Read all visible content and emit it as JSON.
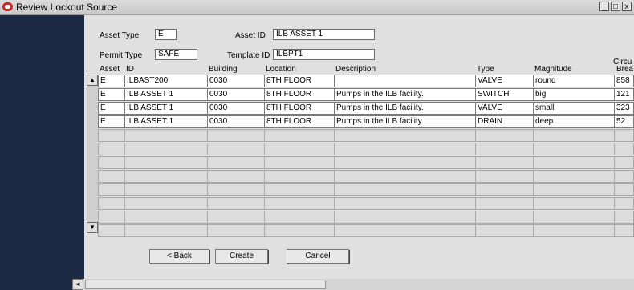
{
  "window": {
    "title": "Review Lockout Source",
    "buttons": [
      "_",
      "□",
      "x"
    ]
  },
  "form": {
    "asset_type_label": "Asset Type",
    "asset_type_value": "E",
    "asset_id_label": "Asset ID",
    "asset_id_value": "ILB ASSET 1",
    "permit_type_label": "Permit Type",
    "permit_type_value": "SAFE",
    "template_id_label": "Template ID",
    "template_id_value": "ILBPT1"
  },
  "table": {
    "columns": [
      "Asset",
      "ID",
      "Building",
      "Location",
      "Description",
      "Type",
      "Magnitude",
      "Circu",
      "Brea"
    ],
    "rows": [
      [
        "E",
        "ILBAST200",
        "0030",
        "8TH FLOOR",
        "",
        "VALVE",
        "round",
        "858"
      ],
      [
        "E",
        "ILB ASSET 1",
        "0030",
        "8TH FLOOR",
        "Pumps in the ILB facility.",
        "SWITCH",
        "big",
        "121"
      ],
      [
        "E",
        "ILB ASSET 1",
        "0030",
        "8TH FLOOR",
        "Pumps in the ILB facility.",
        "VALVE",
        "small",
        "323"
      ],
      [
        "E",
        "ILB ASSET 1",
        "0030",
        "8TH FLOOR",
        "Pumps in the ILB facility.",
        "DRAIN",
        "deep",
        "52"
      ]
    ],
    "empty_row_count": 8
  },
  "actions": {
    "back_label": "< Back",
    "create_label": "Create",
    "cancel_label": "Cancel"
  },
  "scroll": {
    "up_arrow": "▲",
    "down_arrow": "▼",
    "left_arrow": "◄"
  },
  "colors": {
    "left_panel": "#1c2a44",
    "window_bg": "#e0e0e0",
    "oracle_red": "#d6261f"
  }
}
